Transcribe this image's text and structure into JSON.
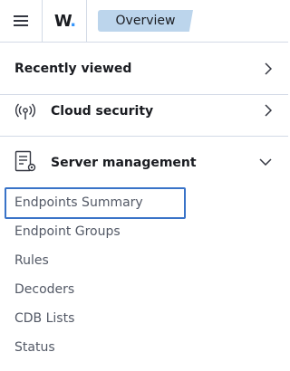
{
  "header": {
    "menu_icon": "hamburger-menu-icon",
    "logo_text": "W",
    "logo_dot": ".",
    "breadcrumb": "Overview"
  },
  "sections": {
    "recently_viewed": {
      "title": "Recently viewed",
      "chevron": "chevron-right-icon"
    },
    "cloud_security": {
      "title": "Cloud security",
      "icon": "cloud-security-icon",
      "chevron": "chevron-right-icon"
    },
    "server_management": {
      "title": "Server management",
      "icon": "server-management-icon",
      "chevron": "chevron-down-icon",
      "links": [
        "Endpoints Summary",
        "Endpoint Groups",
        "Rules",
        "Decoders",
        "CDB Lists",
        "Status"
      ]
    }
  },
  "colors": {
    "accent": "#3973c8",
    "breadcrumb_bg": "#bcd5ec",
    "logo_dot": "#3595f9"
  }
}
